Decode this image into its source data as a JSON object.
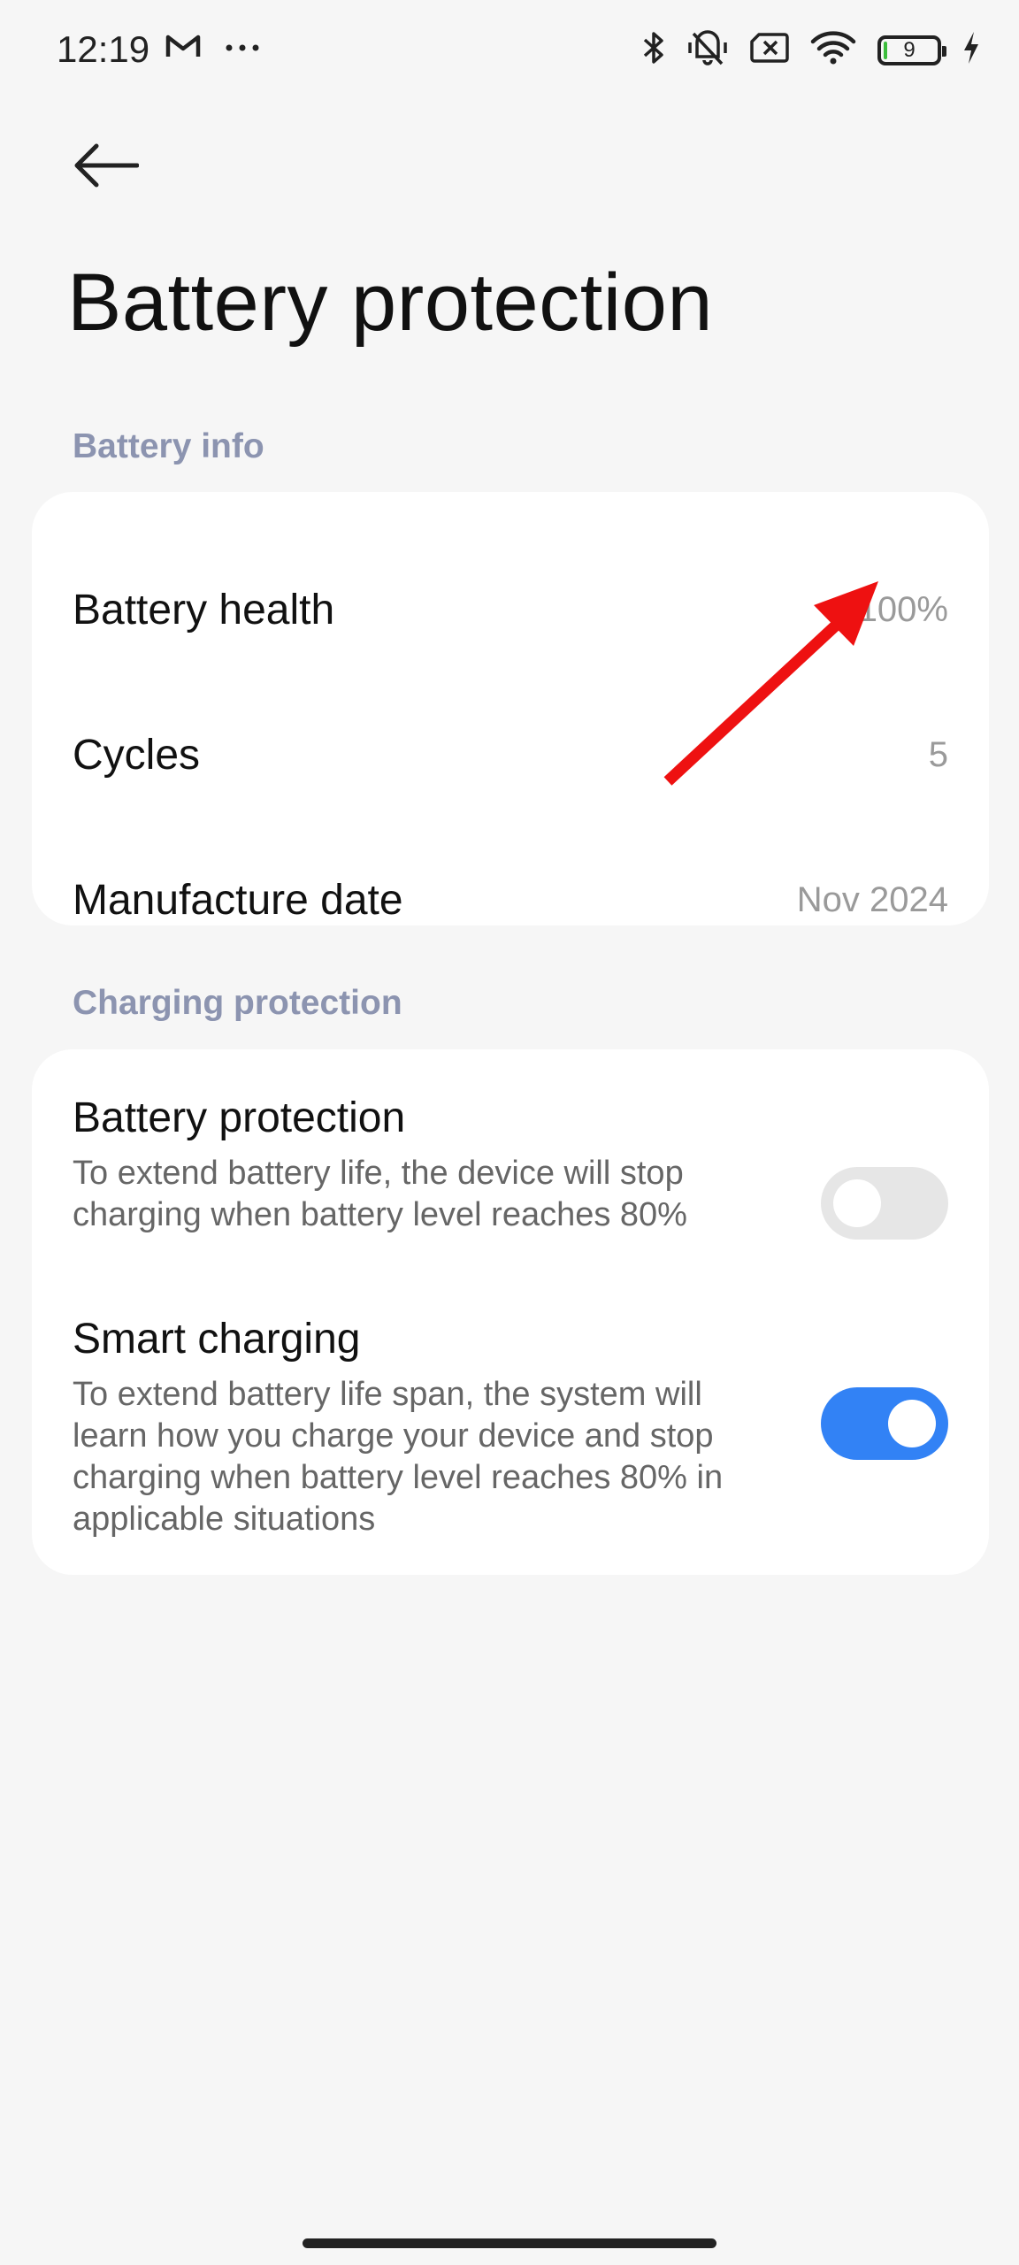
{
  "status_bar": {
    "time": "12:19",
    "left_icons": [
      "gmail-icon",
      "more-dots-icon"
    ],
    "right_icons": [
      "bluetooth-icon",
      "vibrate-off-icon",
      "no-sim-icon",
      "wifi-icon",
      "battery-icon",
      "charging-icon"
    ],
    "battery_level": "9"
  },
  "header": {
    "back_icon": "arrow-left-icon",
    "title": "Battery protection"
  },
  "battery_info": {
    "section_label": "Battery info",
    "rows": [
      {
        "label": "Battery health",
        "value": "100%"
      },
      {
        "label": "Cycles",
        "value": "5"
      },
      {
        "label": "Manufacture date",
        "value": "Nov 2024"
      }
    ]
  },
  "charging_protection": {
    "section_label": "Charging protection",
    "items": [
      {
        "title": "Battery protection",
        "description": "To extend battery life, the device will stop charging when battery level reaches 80%",
        "enabled": false
      },
      {
        "title": "Smart charging",
        "description": "To extend battery life span, the system will learn how you charge your device and stop charging when battery level reaches 80% in applicable situations",
        "enabled": true
      }
    ]
  },
  "colors": {
    "background": "#f6f6f6",
    "card": "#ffffff",
    "section_label": "#8c94b0",
    "toggle_on": "#3282f5",
    "toggle_off": "#e6e6e6",
    "annotation_arrow": "#ee1111"
  }
}
